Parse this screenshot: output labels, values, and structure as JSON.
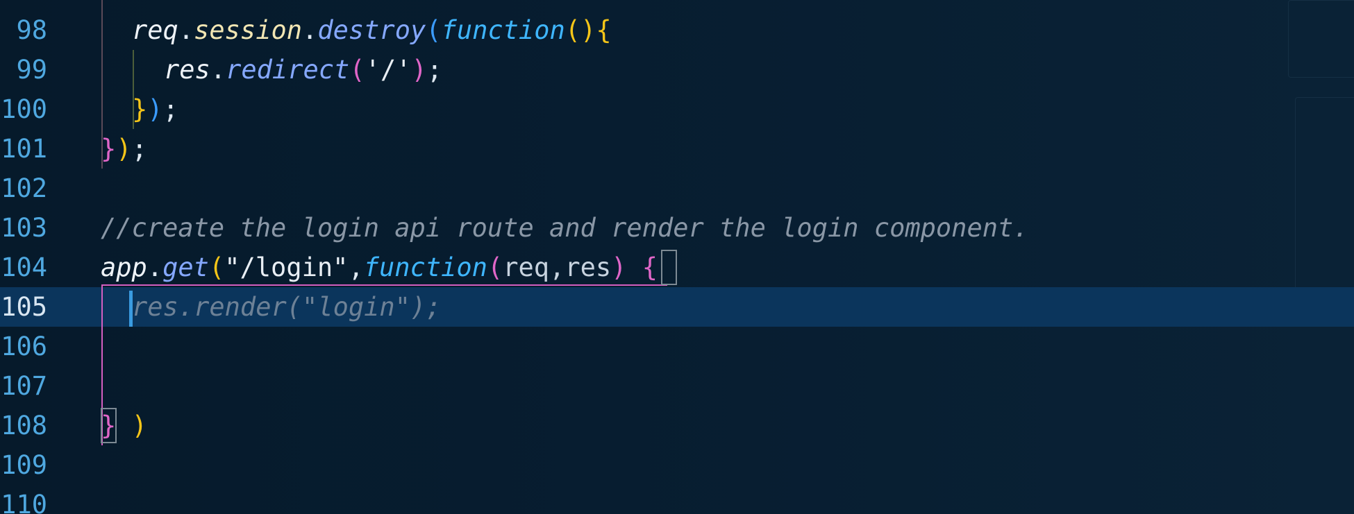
{
  "editor": {
    "language": "javascript",
    "theme_colors": {
      "background": "#071a2b",
      "line_highlight": "#0b355c",
      "line_number": "#4fa8e0",
      "active_line_number": "#d8e6f2",
      "keyword": "#3fb6ff",
      "method": "#85a8ff",
      "comment": "#8a97a6",
      "bracket_1": "#f5c518",
      "bracket_2": "#e066c8",
      "bracket_3": "#3b9cff"
    },
    "active_line": 105,
    "lines": [
      {
        "number": "98"
      },
      {
        "number": "99"
      },
      {
        "number": "100"
      },
      {
        "number": "101"
      },
      {
        "number": "102"
      },
      {
        "number": "103"
      },
      {
        "number": "104"
      },
      {
        "number": "105"
      },
      {
        "number": "106"
      },
      {
        "number": "107"
      },
      {
        "number": "108"
      },
      {
        "number": "109"
      },
      {
        "number": "110"
      }
    ],
    "tokens": {
      "l98": {
        "req": "req",
        "dot1": ".",
        "session": "session",
        "dot2": ".",
        "destroy": "destroy",
        "open": "(",
        "function": "function",
        "parens": "()",
        "brace": "{"
      },
      "l99": {
        "res": "res",
        "dot": ".",
        "redirect": "redirect",
        "open": "(",
        "str": "'/'",
        "close": ")",
        "semi": ";"
      },
      "l100": {
        "brace": "}",
        "paren": ")",
        "semi": ";"
      },
      "l101": {
        "brace": "}",
        "paren": ")",
        "semi": ";"
      },
      "l103": {
        "comment": "//create the login api route and render the login component."
      },
      "l104": {
        "app": "app",
        "dot": ".",
        "get": "get",
        "open": "(",
        "str": "\"/login\"",
        "comma": ",",
        "function": "function",
        "popen": "(",
        "params": "req,res",
        "pclose": ")",
        "brace": "{"
      },
      "l105": {
        "suggestion": "res.render(\"login\");"
      },
      "l108": {
        "brace": "}",
        "paren": ")"
      }
    }
  }
}
